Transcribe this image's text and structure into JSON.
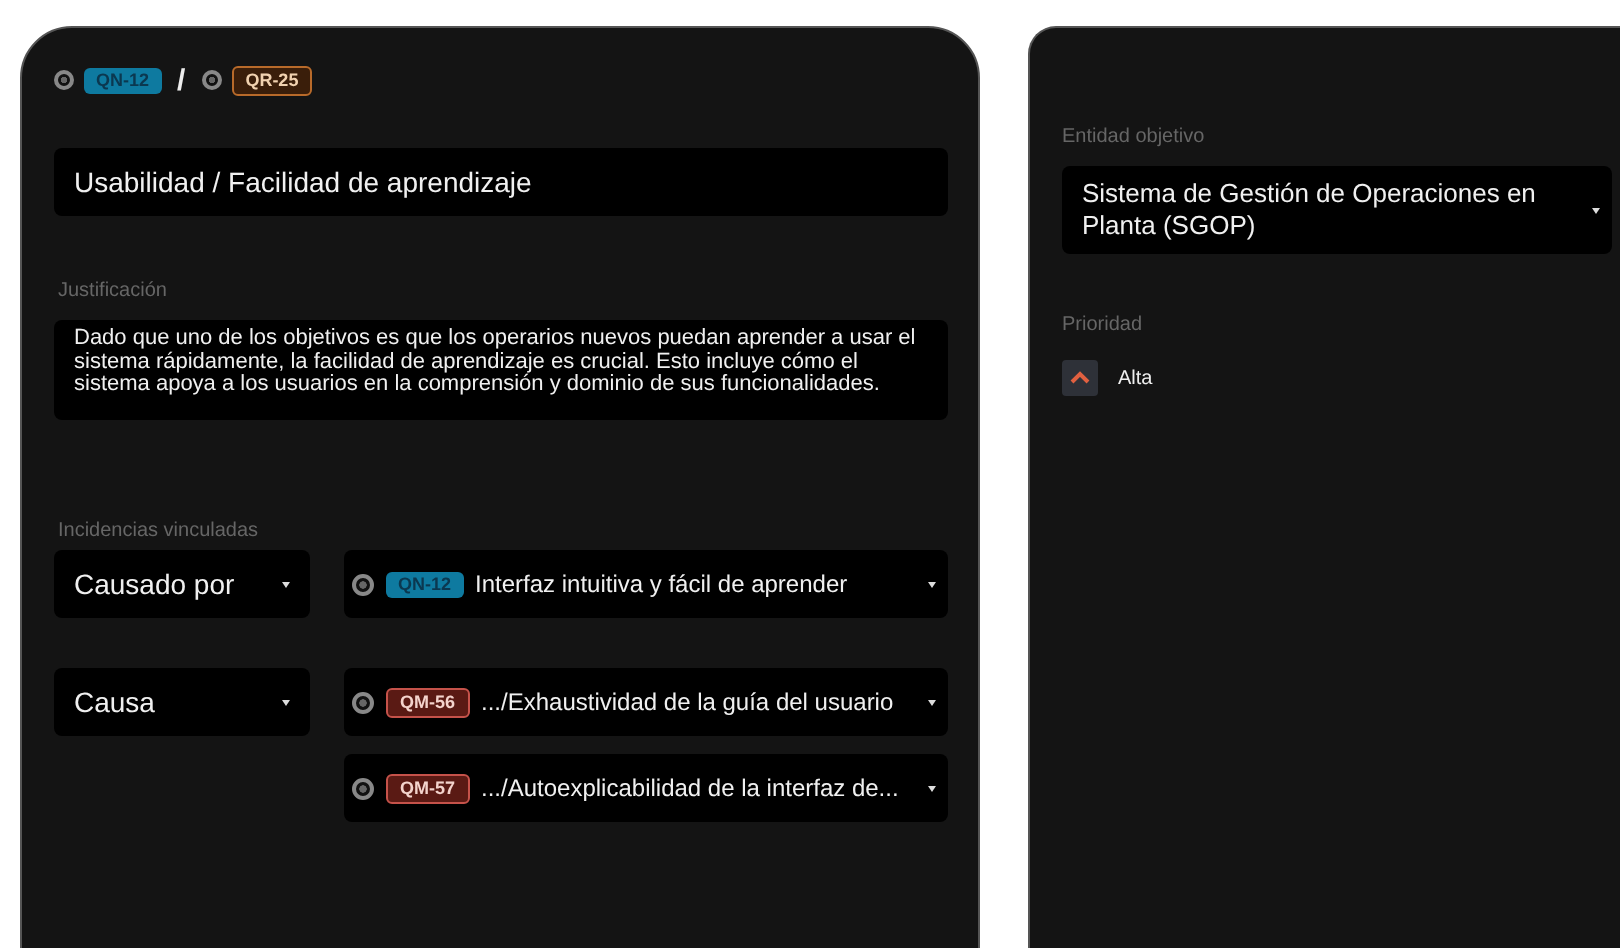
{
  "header": {
    "codes": [
      {
        "code": "QN-12",
        "kind": "qn"
      },
      {
        "code": "QR-25",
        "kind": "qr"
      }
    ],
    "separator": "/"
  },
  "title": "Usabilidad / Facilidad de aprendizaje",
  "justification": {
    "label": "Justificación",
    "text": "Dado que uno de los objetivos es que los operarios nuevos puedan aprender a usar el sistema rápidamente, la facilidad de aprendizaje es crucial. Esto incluye cómo el sistema apoya a los usuarios en la comprensión y dominio de sus funcionalidades."
  },
  "links": {
    "label": "Incidencias vinculadas",
    "groups": [
      {
        "relation": "Causado por",
        "items": [
          {
            "code": "QN-12",
            "kind": "qn",
            "text": "Interfaz intuitiva y fácil de aprender"
          }
        ]
      },
      {
        "relation": "Causa",
        "items": [
          {
            "code": "QM-56",
            "kind": "qm",
            "text": ".../Exhaustividad de la guía del usuario"
          },
          {
            "code": "QM-57",
            "kind": "qm",
            "text": ".../Autoexplicabilidad de la interfaz de..."
          }
        ]
      }
    ]
  },
  "target": {
    "label": "Entidad objetivo",
    "value": "Sistema de Gestión de Operaciones en Planta (SGOP)"
  },
  "priority": {
    "label": "Prioridad",
    "value": "Alta"
  }
}
